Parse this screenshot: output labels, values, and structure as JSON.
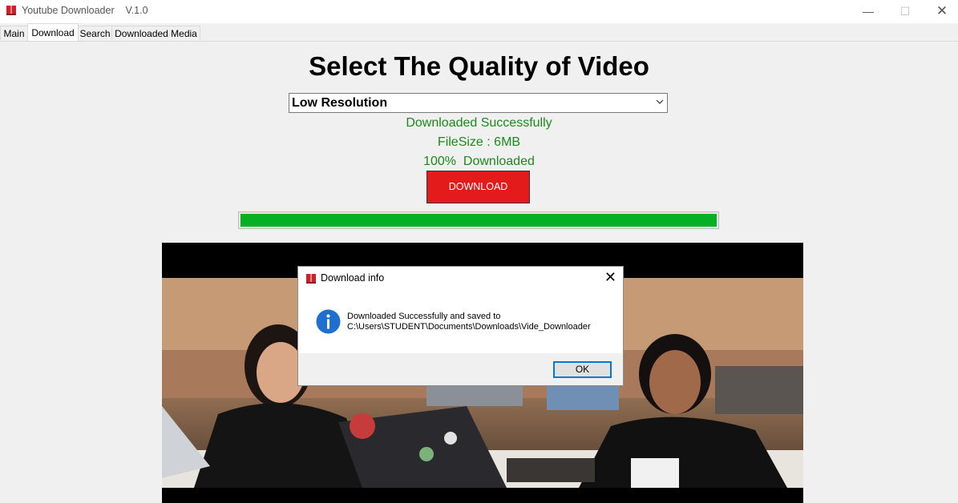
{
  "window": {
    "title": "Youtube Downloader    V.1.0",
    "minimize_glyph": "—",
    "maximize_glyph": "☐",
    "close_glyph": "✕",
    "app_icon": "book-icon"
  },
  "tabs": [
    {
      "label": "Main",
      "active": false
    },
    {
      "label": "Download",
      "active": true
    },
    {
      "label": "Search",
      "active": false
    },
    {
      "label": "Downloaded Media",
      "active": false
    }
  ],
  "main": {
    "heading": "Select The Quality of Video",
    "quality_select": {
      "value": "Low Resolution"
    },
    "status_success": "Downloaded Successfully",
    "status_filesize": "FileSize : 6MB",
    "status_progress": "100%  Downloaded",
    "download_button": "DOWNLOAD",
    "progress_fraction": 1.0
  },
  "dialog": {
    "title": "Download info",
    "close_glyph": "✕",
    "message_line1": "Downloaded Successfully and saved to",
    "message_line2": "C:\\Users\\STUDENT\\Documents\\Downloads\\Vide_Downloader",
    "ok_label": "OK",
    "icon": "info-icon"
  },
  "colors": {
    "status_green": "#1a8a1a",
    "download_red": "#e31b1b",
    "progress_green": "#06b025",
    "dialog_accent": "#0078d7"
  }
}
